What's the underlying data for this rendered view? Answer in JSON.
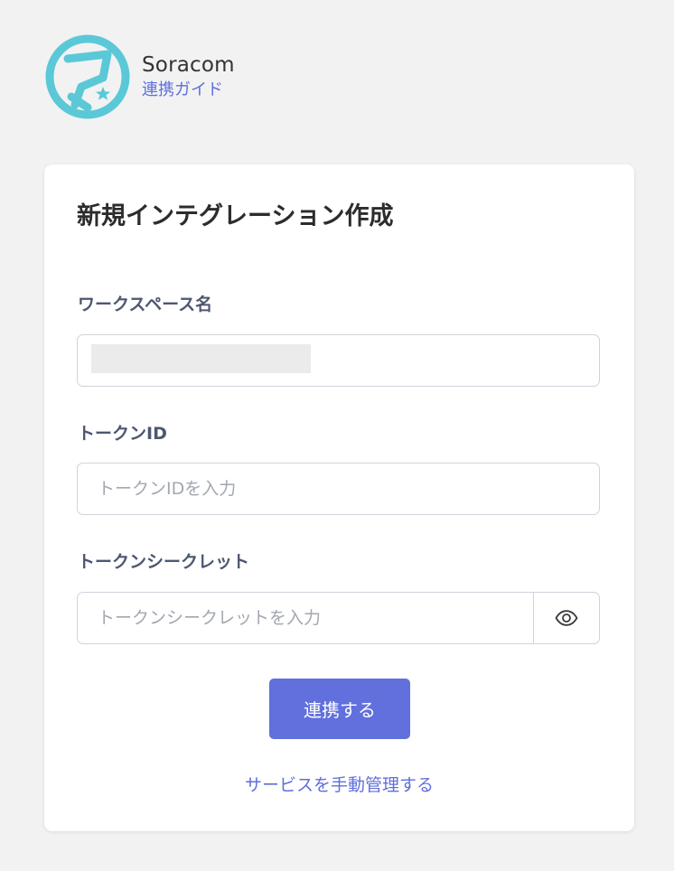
{
  "header": {
    "brand_name": "Soracom",
    "guide_link": "連携ガイド",
    "logo_icon": "soracom-logo-icon",
    "logo_color": "#5bc8d7"
  },
  "form": {
    "title": "新規インテグレーション作成",
    "workspace": {
      "label": "ワークスペース名",
      "value": ""
    },
    "token_id": {
      "label": "トークンID",
      "placeholder": "トークンIDを入力",
      "value": ""
    },
    "token_secret": {
      "label": "トークンシークレット",
      "placeholder": "トークンシークレットを入力",
      "value": "",
      "toggle_icon": "eye-icon"
    },
    "connect_button": "連携する",
    "manual_link": "サービスを手動管理する"
  },
  "colors": {
    "accent": "#6170dc",
    "link": "#5f6fdb",
    "page_background": "#f2f2f2"
  }
}
